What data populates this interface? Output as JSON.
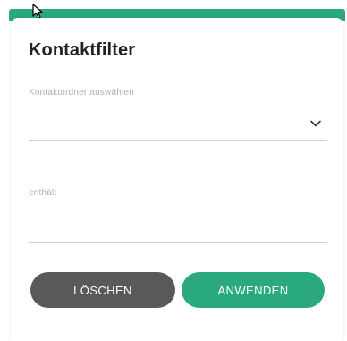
{
  "dialog": {
    "title": "Kontaktfilter"
  },
  "folder_select": {
    "label": "Kontaktordner auswählen",
    "value": "",
    "icon": "chevron-down-icon"
  },
  "contains_field": {
    "label": "enthält",
    "value": ""
  },
  "buttons": {
    "clear_label": "LÖSCHEN",
    "apply_label": "ANWENDEN"
  },
  "colors": {
    "accent": "#2aa87e",
    "clear_button": "#595959"
  }
}
